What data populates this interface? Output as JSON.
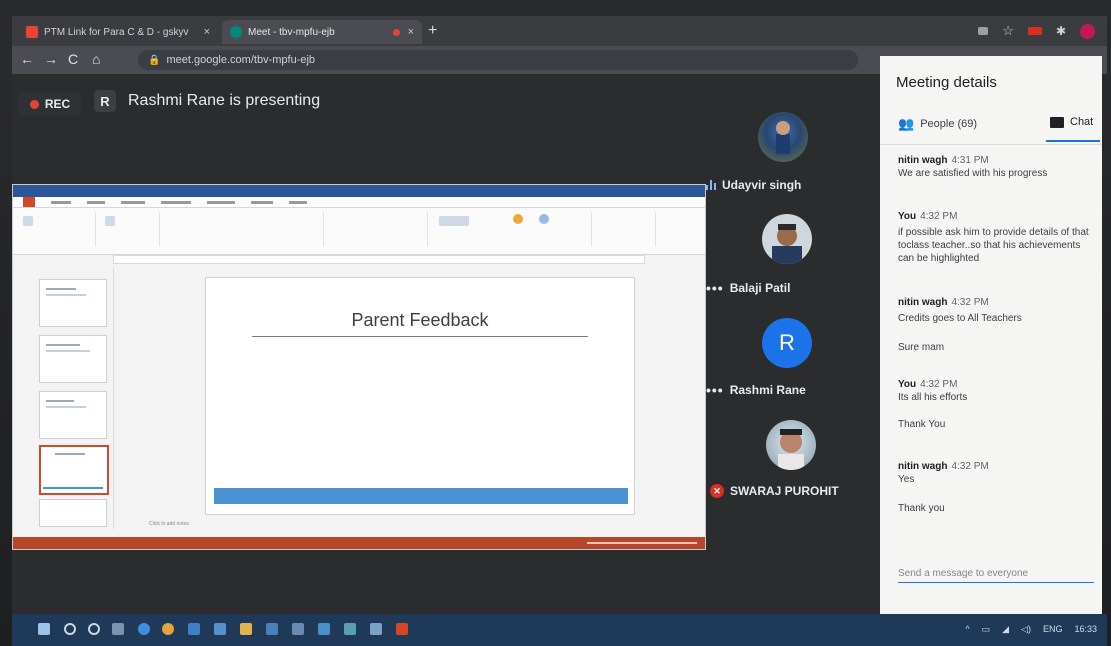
{
  "browser": {
    "tabs": [
      {
        "label": "PTM Link for Para C & D - gskyv",
        "icon": "gmail-icon",
        "color": "#ea4335"
      },
      {
        "label": "Meet - tbv-mpfu-ejb",
        "icon": "meet-icon",
        "color": "#00897b"
      }
    ],
    "url": "meet.google.com/tbv-mpfu-ejb"
  },
  "meet": {
    "rec_label": "REC",
    "presenter_initial": "R",
    "presenter_text": "Rashmi Rane is presenting"
  },
  "slide": {
    "title": "Parent Feedback",
    "notes_placeholder": "Click to add notes"
  },
  "participants": [
    {
      "name": "Udayvir singh",
      "status": "speaking"
    },
    {
      "name": "Balaji Patil",
      "status": "more"
    },
    {
      "name": "Rashmi Rane",
      "initial": "R",
      "status": "more"
    },
    {
      "name": "SWARAJ PUROHIT",
      "status": "muted"
    }
  ],
  "panel": {
    "title": "Meeting details",
    "people_label": "People (69)",
    "chat_label": "Chat",
    "messages": [
      {
        "sender": "nitin wagh",
        "time": "4:31 PM",
        "lines": [
          "We are satisfied with his progress"
        ]
      },
      {
        "sender": "You",
        "time": "4:32 PM",
        "lines": [
          "if possible ask him to provide details of that toclass teacher..so that his achievements can be highlighted"
        ]
      },
      {
        "sender": "nitin wagh",
        "time": "4:32 PM",
        "lines": [
          "Credits goes to All Teachers",
          "Sure mam"
        ]
      },
      {
        "sender": "You",
        "time": "4:32 PM",
        "lines": [
          "Its all his efforts",
          "Thank You"
        ]
      },
      {
        "sender": "nitin wagh",
        "time": "4:32 PM",
        "lines": [
          "Yes",
          "Thank you"
        ]
      }
    ],
    "compose_placeholder": "Send a message to everyone"
  },
  "taskbar": {
    "language": "ENG",
    "time": "16:33"
  },
  "colors": {
    "meet_bg": "#2b2c2e",
    "panel_bg": "#f5f6f4",
    "accent_blue": "#1a73e8",
    "avatar_blue": "#1a73e8",
    "rec_red": "#e94235",
    "ppt_blue_band": "#4a93d0",
    "ppt_status": "#b7472a"
  }
}
